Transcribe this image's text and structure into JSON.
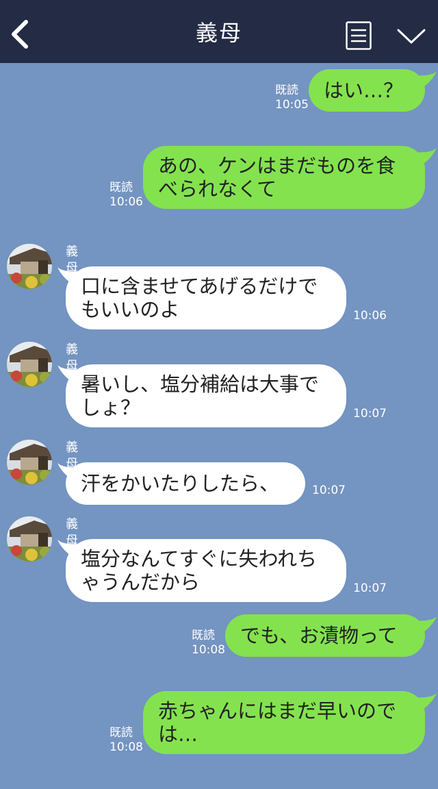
{
  "header": {
    "title": "義母"
  },
  "colors": {
    "header_bg": "#232b45",
    "chat_bg": "#7494c1",
    "sent_bubble": "#84e24f",
    "received_bubble": "#ffffff"
  },
  "icons": {
    "back": "chevron-left-icon",
    "menu": "menu-icon",
    "more": "chevron-down-icon"
  },
  "messages": [
    {
      "side": "sent",
      "lines": [
        "はい…？"
      ],
      "read": "既読",
      "time": "10:05"
    },
    {
      "side": "sent",
      "lines": [
        "あの、ケンはまだものを食",
        "べられなくて"
      ],
      "read": "既読",
      "time": "10:06"
    },
    {
      "side": "received",
      "sender": "義母",
      "lines": [
        "口に含ませてあげるだけで",
        "もいいのよ"
      ],
      "time": "10:06"
    },
    {
      "side": "received",
      "sender": "義母",
      "lines": [
        "暑いし、塩分補給は大事で",
        "しょ？"
      ],
      "time": "10:07"
    },
    {
      "side": "received",
      "sender": "義母",
      "lines": [
        "汗をかいたりしたら、"
      ],
      "time": "10:07"
    },
    {
      "side": "received",
      "sender": "義母",
      "lines": [
        "塩分なんてすぐに失われち",
        "ゃうんだから"
      ],
      "time": "10:07"
    },
    {
      "side": "sent",
      "lines": [
        "でも、お漬物って"
      ],
      "read": "既読",
      "time": "10:08"
    },
    {
      "side": "sent",
      "lines": [
        "赤ちゃんにはまだ早いので",
        "は…"
      ],
      "read": "既読",
      "time": "10:08"
    }
  ]
}
